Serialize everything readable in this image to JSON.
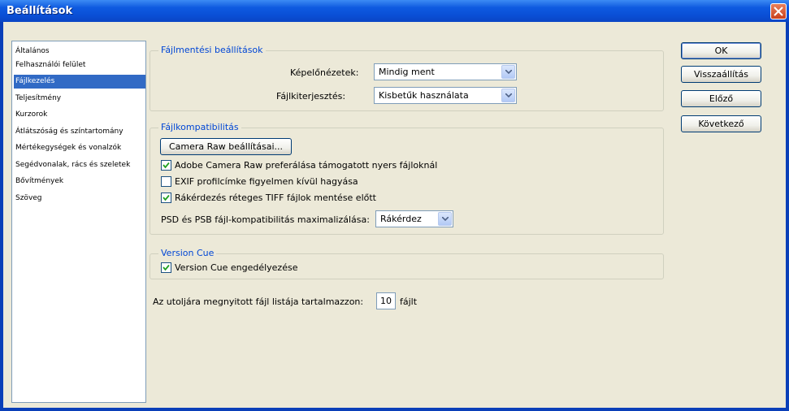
{
  "window": {
    "title": "Beállítások"
  },
  "sidebar": {
    "items": [
      {
        "label": "Általános"
      },
      {
        "label": "Felhasználói felület"
      },
      {
        "label": "Fájlkezelés"
      },
      {
        "label": "Teljesítmény"
      },
      {
        "label": "Kurzorok"
      },
      {
        "label": "Átlátszóság és színtartomány"
      },
      {
        "label": "Mértékegységek és vonalzók"
      },
      {
        "label": "Segédvonalak, rács és szeletek"
      },
      {
        "label": "Bővítmények"
      },
      {
        "label": "Szöveg"
      }
    ],
    "selected_index": 2
  },
  "file_saving": {
    "legend": "Fájlmentési beállítások",
    "preview_label": "Képelőnézetek:",
    "preview_value": "Mindig ment",
    "extension_label": "Fájlkiterjesztés:",
    "extension_value": "Kisbetűk használata"
  },
  "compat": {
    "legend": "Fájlkompatibilitás",
    "camera_raw_button": "Camera Raw beállításai...",
    "opt_camera_raw": "Adobe Camera Raw preferálása támogatott nyers fájloknál",
    "opt_camera_raw_checked": true,
    "opt_exif": "EXIF profilcímke figyelmen kívül hagyása",
    "opt_exif_checked": false,
    "opt_tiff": "Rákérdezés réteges TIFF fájlok mentése előtt",
    "opt_tiff_checked": true,
    "psd_label": "PSD és PSB fájl-kompatibilitás maximalizálása:",
    "psd_value": "Rákérdez"
  },
  "version_cue": {
    "legend": "Version Cue",
    "enable_label": "Version Cue engedélyezése",
    "enable_checked": true
  },
  "recent": {
    "label_before": "Az utoljára megnyitott fájl listája tartalmazzon:",
    "value": "10",
    "label_after": "fájlt"
  },
  "buttons": {
    "ok": "OK",
    "reset": "Visszaállítás",
    "prev": "Előző",
    "next": "Következő"
  }
}
